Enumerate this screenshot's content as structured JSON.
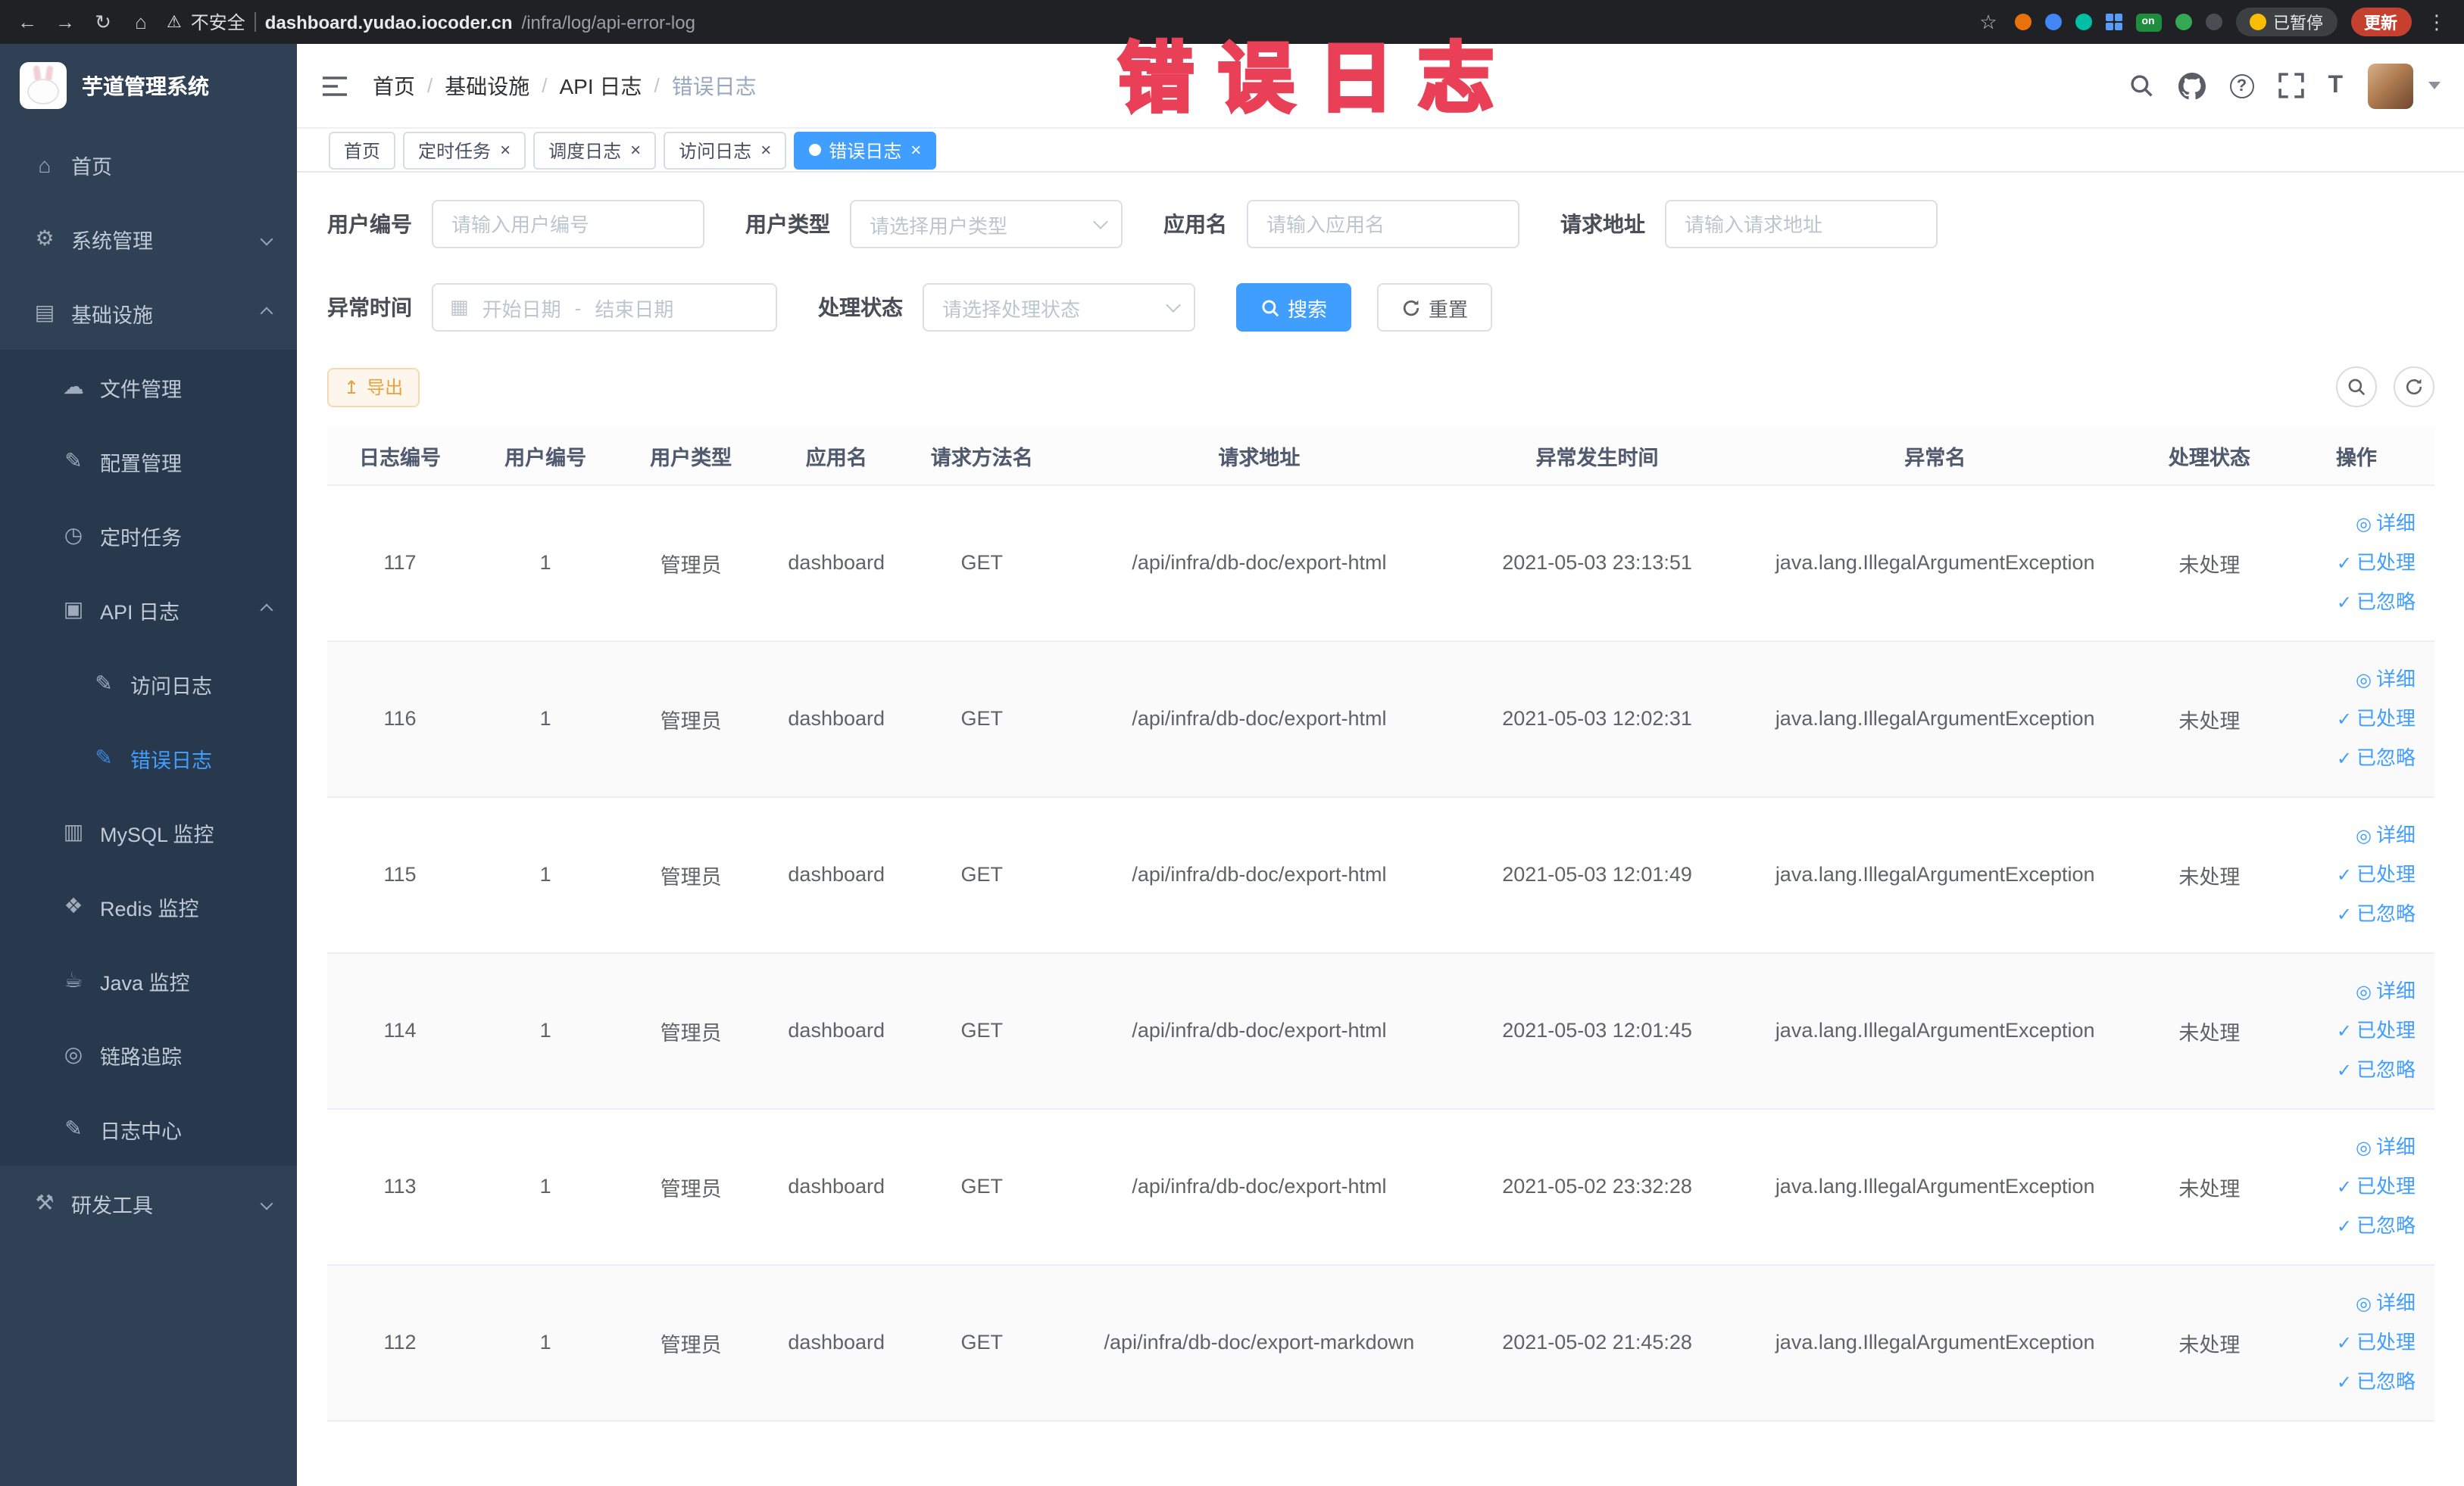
{
  "ui": {
    "close_glyph": "×",
    "breadcrumb_separator": "/",
    "eye_glyph": "◎",
    "check_glyph": "✓",
    "help_glyph": "?",
    "font_glyph": "T"
  },
  "icons": {
    "back": "←",
    "forward": "→",
    "reload": "↻",
    "home": "⌂",
    "warning": "⚠",
    "star": "☆",
    "menu_dots": "⋮",
    "calendar": "▦",
    "export": "↥"
  },
  "browser": {
    "security_label": "不安全",
    "url_domain": "dashboard.yudao.iocoder.cn",
    "url_path": "/infra/log/api-error-log",
    "extension_on_label": "on",
    "paused_label": "已暂停",
    "update_label": "更新"
  },
  "annotation": {
    "text": "错误日志"
  },
  "sidebar": {
    "title": "芋道管理系统",
    "items": [
      {
        "label": "首页",
        "glyph": "⌂"
      },
      {
        "label": "系统管理",
        "glyph": "⚙"
      },
      {
        "label": "基础设施",
        "glyph": "▤"
      },
      {
        "label": "文件管理",
        "glyph": "☁"
      },
      {
        "label": "配置管理",
        "glyph": "✎"
      },
      {
        "label": "定时任务",
        "glyph": "◷"
      },
      {
        "label": "API 日志",
        "glyph": "▣"
      },
      {
        "label": "访问日志",
        "glyph": "✎"
      },
      {
        "label": "错误日志",
        "glyph": "✎"
      },
      {
        "label": "MySQL 监控",
        "glyph": "▥"
      },
      {
        "label": "Redis 监控",
        "glyph": "❖"
      },
      {
        "label": "Java 监控",
        "glyph": "☕"
      },
      {
        "label": "链路追踪",
        "glyph": "◎"
      },
      {
        "label": "日志中心",
        "glyph": "✎"
      },
      {
        "label": "研发工具",
        "glyph": "⚒"
      }
    ]
  },
  "header": {
    "breadcrumb": [
      "首页",
      "基础设施",
      "API 日志",
      "错误日志"
    ]
  },
  "tabs": [
    {
      "label": "首页"
    },
    {
      "label": "定时任务"
    },
    {
      "label": "调度日志"
    },
    {
      "label": "访问日志"
    },
    {
      "label": "错误日志"
    }
  ],
  "filters": {
    "user_id_label": "用户编号",
    "user_id_placeholder": "请输入用户编号",
    "user_type_label": "用户类型",
    "user_type_placeholder": "请选择用户类型",
    "app_name_label": "应用名",
    "app_name_placeholder": "请输入应用名",
    "request_url_label": "请求地址",
    "request_url_placeholder": "请输入请求地址",
    "time_label": "异常时间",
    "time_start_placeholder": "开始日期",
    "time_separator": "-",
    "time_end_placeholder": "结束日期",
    "status_label": "处理状态",
    "status_placeholder": "请选择处理状态",
    "search_label": "搜索",
    "reset_label": "重置"
  },
  "toolbar": {
    "export_label": "导出"
  },
  "table": {
    "columns": [
      "日志编号",
      "用户编号",
      "用户类型",
      "应用名",
      "请求方法名",
      "请求地址",
      "异常发生时间",
      "异常名",
      "处理状态",
      "操作"
    ],
    "actions": [
      "详细",
      "已处理",
      "已忽略"
    ],
    "rows": [
      {
        "log_id": "117",
        "user_id": "1",
        "user_type": "管理员",
        "app_name": "dashboard",
        "method": "GET",
        "url": "/api/infra/db-doc/export-html",
        "time": "2021-05-03 23:13:51",
        "exception": "java.lang.IllegalArgumentException",
        "status": "未处理"
      },
      {
        "log_id": "116",
        "user_id": "1",
        "user_type": "管理员",
        "app_name": "dashboard",
        "method": "GET",
        "url": "/api/infra/db-doc/export-html",
        "time": "2021-05-03 12:02:31",
        "exception": "java.lang.IllegalArgumentException",
        "status": "未处理"
      },
      {
        "log_id": "115",
        "user_id": "1",
        "user_type": "管理员",
        "app_name": "dashboard",
        "method": "GET",
        "url": "/api/infra/db-doc/export-html",
        "time": "2021-05-03 12:01:49",
        "exception": "java.lang.IllegalArgumentException",
        "status": "未处理"
      },
      {
        "log_id": "114",
        "user_id": "1",
        "user_type": "管理员",
        "app_name": "dashboard",
        "method": "GET",
        "url": "/api/infra/db-doc/export-html",
        "time": "2021-05-03 12:01:45",
        "exception": "java.lang.IllegalArgumentException",
        "status": "未处理"
      },
      {
        "log_id": "113",
        "user_id": "1",
        "user_type": "管理员",
        "app_name": "dashboard",
        "method": "GET",
        "url": "/api/infra/db-doc/export-html",
        "time": "2021-05-02 23:32:28",
        "exception": "java.lang.IllegalArgumentException",
        "status": "未处理"
      },
      {
        "log_id": "112",
        "user_id": "1",
        "user_type": "管理员",
        "app_name": "dashboard",
        "method": "GET",
        "url": "/api/infra/db-doc/export-markdown",
        "time": "2021-05-02 21:45:28",
        "exception": "java.lang.IllegalArgumentException",
        "status": "未处理"
      }
    ]
  },
  "colors": {
    "accent": "#409eff",
    "sidebar_bg": "#304156",
    "warning": "#e6a23c",
    "annotation": "#ee4158"
  }
}
